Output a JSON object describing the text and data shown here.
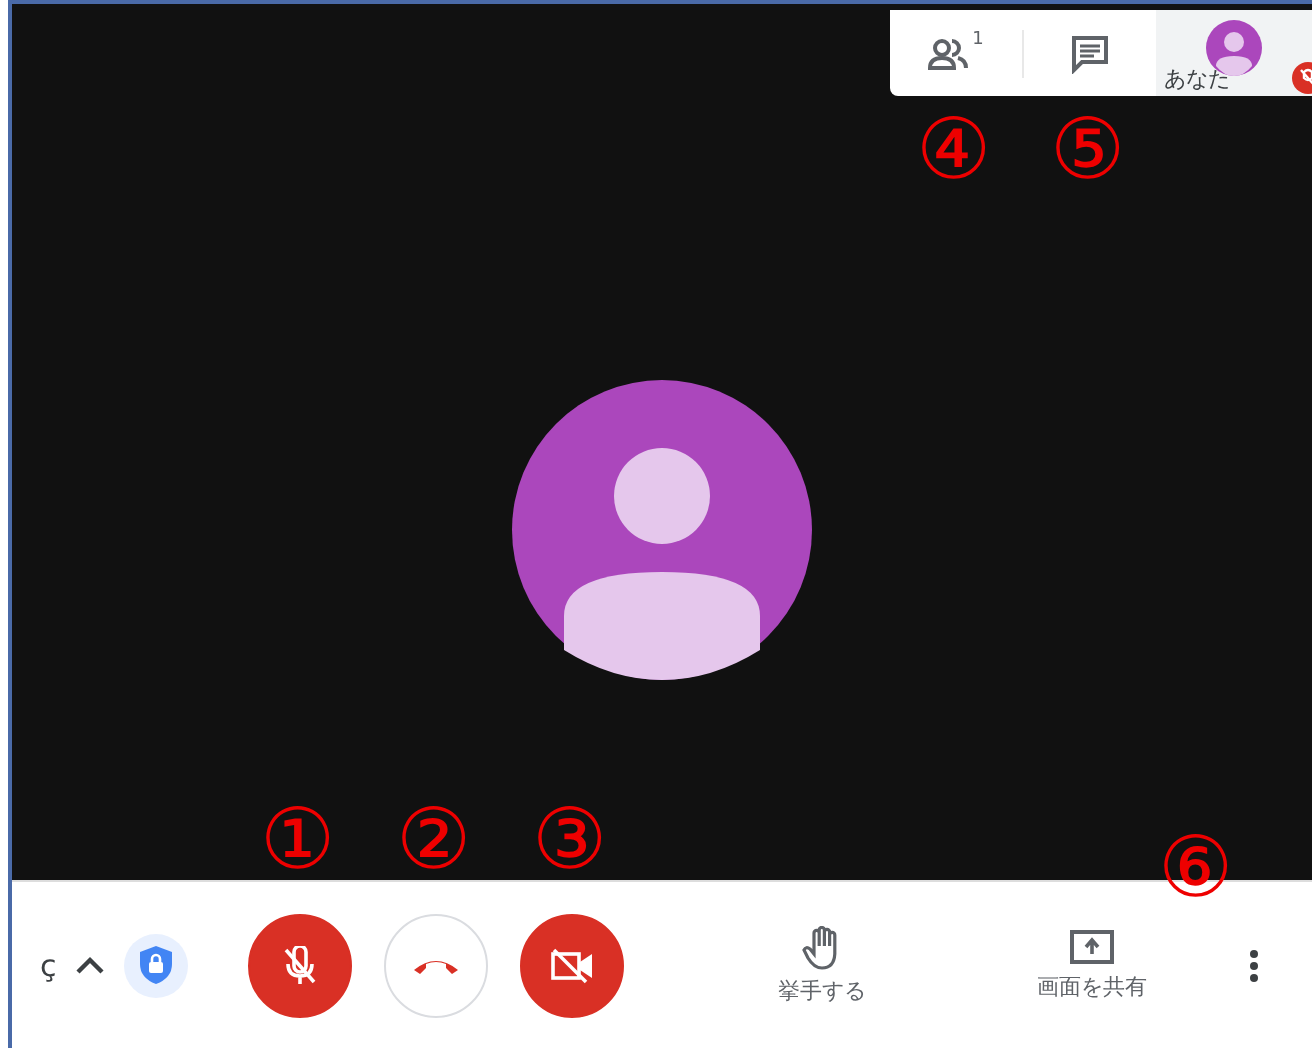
{
  "top_panel": {
    "people_count": "1",
    "self": {
      "label": "あなた",
      "muted": true
    }
  },
  "stage": {
    "kind": "avatar"
  },
  "bottom_bar": {
    "meeting_code": "ç",
    "details_expanded": false,
    "mic": {
      "muted": true
    },
    "camera": {
      "off": true
    },
    "actions": [
      {
        "kind": "raise-hand",
        "label": "挙手する"
      },
      {
        "kind": "share",
        "label": "画面を共有"
      }
    ]
  },
  "annotations": [
    {
      "label": "①",
      "kind": "mic"
    },
    {
      "label": "②",
      "kind": "hangup"
    },
    {
      "label": "③",
      "kind": "camera"
    },
    {
      "label": "④",
      "kind": "people"
    },
    {
      "label": "⑤",
      "kind": "chat"
    },
    {
      "label": "⑥",
      "kind": "more"
    }
  ]
}
